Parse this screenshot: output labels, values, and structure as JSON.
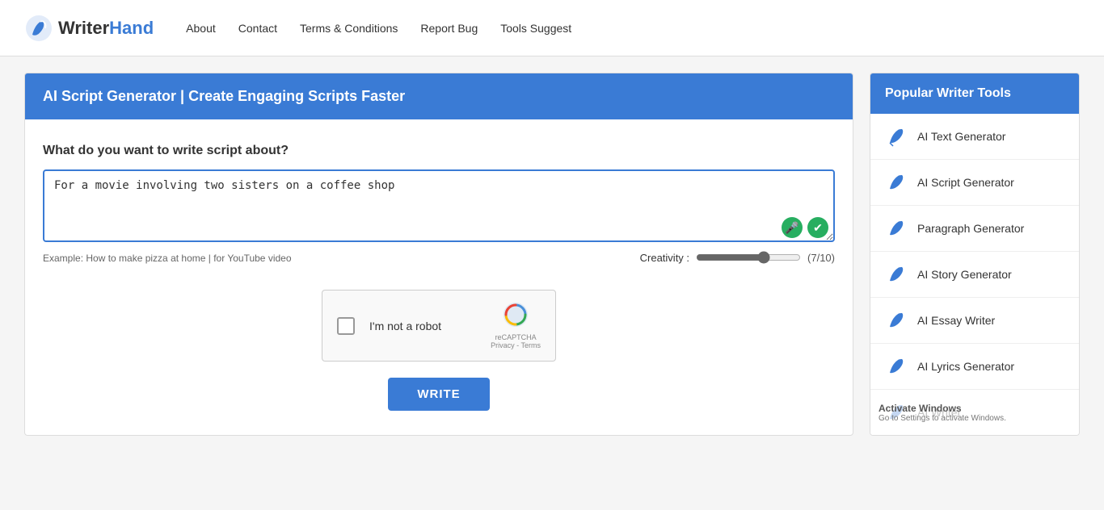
{
  "header": {
    "logo_text_writer": "Writer",
    "logo_text_hand": "Hand",
    "nav": [
      {
        "label": "About",
        "href": "#"
      },
      {
        "label": "Contact",
        "href": "#"
      },
      {
        "label": "Terms & Conditions",
        "href": "#"
      },
      {
        "label": "Report Bug",
        "href": "#"
      },
      {
        "label": "Tools Suggest",
        "href": "#"
      }
    ]
  },
  "content": {
    "title": "AI Script Generator | Create Engaging Scripts Faster",
    "prompt_label": "What do you want to write script about?",
    "textarea_value": "For a movie involving two sisters on a coffee shop",
    "hint_text": "Example: How to make pizza at home | for YouTube video",
    "creativity_label": "Creativity :",
    "creativity_value": "(7/10)",
    "write_button_label": "WRITE"
  },
  "captcha": {
    "label": "I'm not a robot",
    "logo": "reCAPTCHA",
    "sub1": "Privacy - Terms"
  },
  "sidebar": {
    "header": "Popular Writer Tools",
    "items": [
      {
        "label": "AI Text Generator",
        "icon": "feather"
      },
      {
        "label": "AI Script Generator",
        "icon": "feather"
      },
      {
        "label": "Paragraph Generator",
        "icon": "feather"
      },
      {
        "label": "AI Story Generator",
        "icon": "feather"
      },
      {
        "label": "AI Essay Writer",
        "icon": "feather"
      },
      {
        "label": "AI Lyrics Generator",
        "icon": "feather"
      },
      {
        "label": "AI Writer",
        "icon": "feather"
      }
    ]
  },
  "windows_activate": {
    "title": "Activate Windows",
    "sub": "Go to Settings to activate Windows."
  }
}
